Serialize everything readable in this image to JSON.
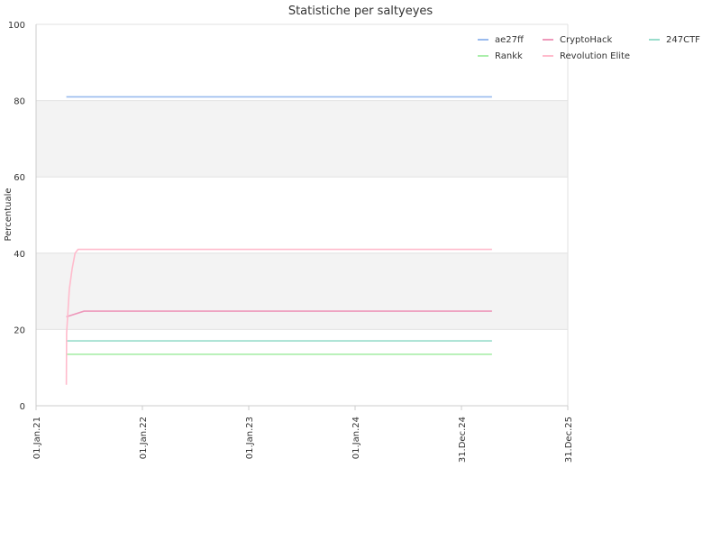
{
  "chart_data": {
    "type": "line",
    "title": "Statistiche per saltyeyes",
    "xlabel": "",
    "ylabel": "Percentuale",
    "ylim": [
      0,
      100
    ],
    "yticks": [
      0,
      20,
      40,
      60,
      80,
      100
    ],
    "xlim": [
      "2021-01-01",
      "2025-12-31"
    ],
    "xticks": [
      {
        "date": "2021-01-01",
        "label": "01.Jan.21"
      },
      {
        "date": "2022-01-01",
        "label": "01.Jan.22"
      },
      {
        "date": "2023-01-01",
        "label": "01.Jan.23"
      },
      {
        "date": "2024-01-01",
        "label": "01.Jan.24"
      },
      {
        "date": "2024-12-31",
        "label": "31.Dec.24"
      },
      {
        "date": "2025-12-31",
        "label": "31.Dec.25"
      }
    ],
    "grid": true,
    "legend_position": "top-right",
    "series": [
      {
        "name": "ae27ff",
        "color": "#99bbee",
        "points": [
          [
            "2021-04-15",
            81
          ],
          [
            "2025-04-15",
            81
          ]
        ]
      },
      {
        "name": "CryptoHack",
        "color": "#ee99bb",
        "points": [
          [
            "2021-04-15",
            23.3
          ],
          [
            "2021-06-15",
            24.8
          ],
          [
            "2025-04-15",
            24.8
          ]
        ]
      },
      {
        "name": "247CTF",
        "color": "#99ddcc",
        "points": [
          [
            "2021-04-15",
            17
          ],
          [
            "2025-04-15",
            17
          ]
        ]
      },
      {
        "name": "Rankk",
        "color": "#aaeeaa",
        "points": [
          [
            "2021-04-15",
            13.5
          ],
          [
            "2025-04-15",
            13.5
          ]
        ]
      },
      {
        "name": "Revolution Elite",
        "color": "#ffbbcc",
        "points": [
          [
            "2021-04-15",
            5.5
          ],
          [
            "2021-04-16",
            19
          ],
          [
            "2021-04-25",
            30.5
          ],
          [
            "2021-05-05",
            36
          ],
          [
            "2021-05-15",
            40
          ],
          [
            "2021-05-25",
            41
          ],
          [
            "2025-04-15",
            41
          ]
        ]
      }
    ]
  }
}
